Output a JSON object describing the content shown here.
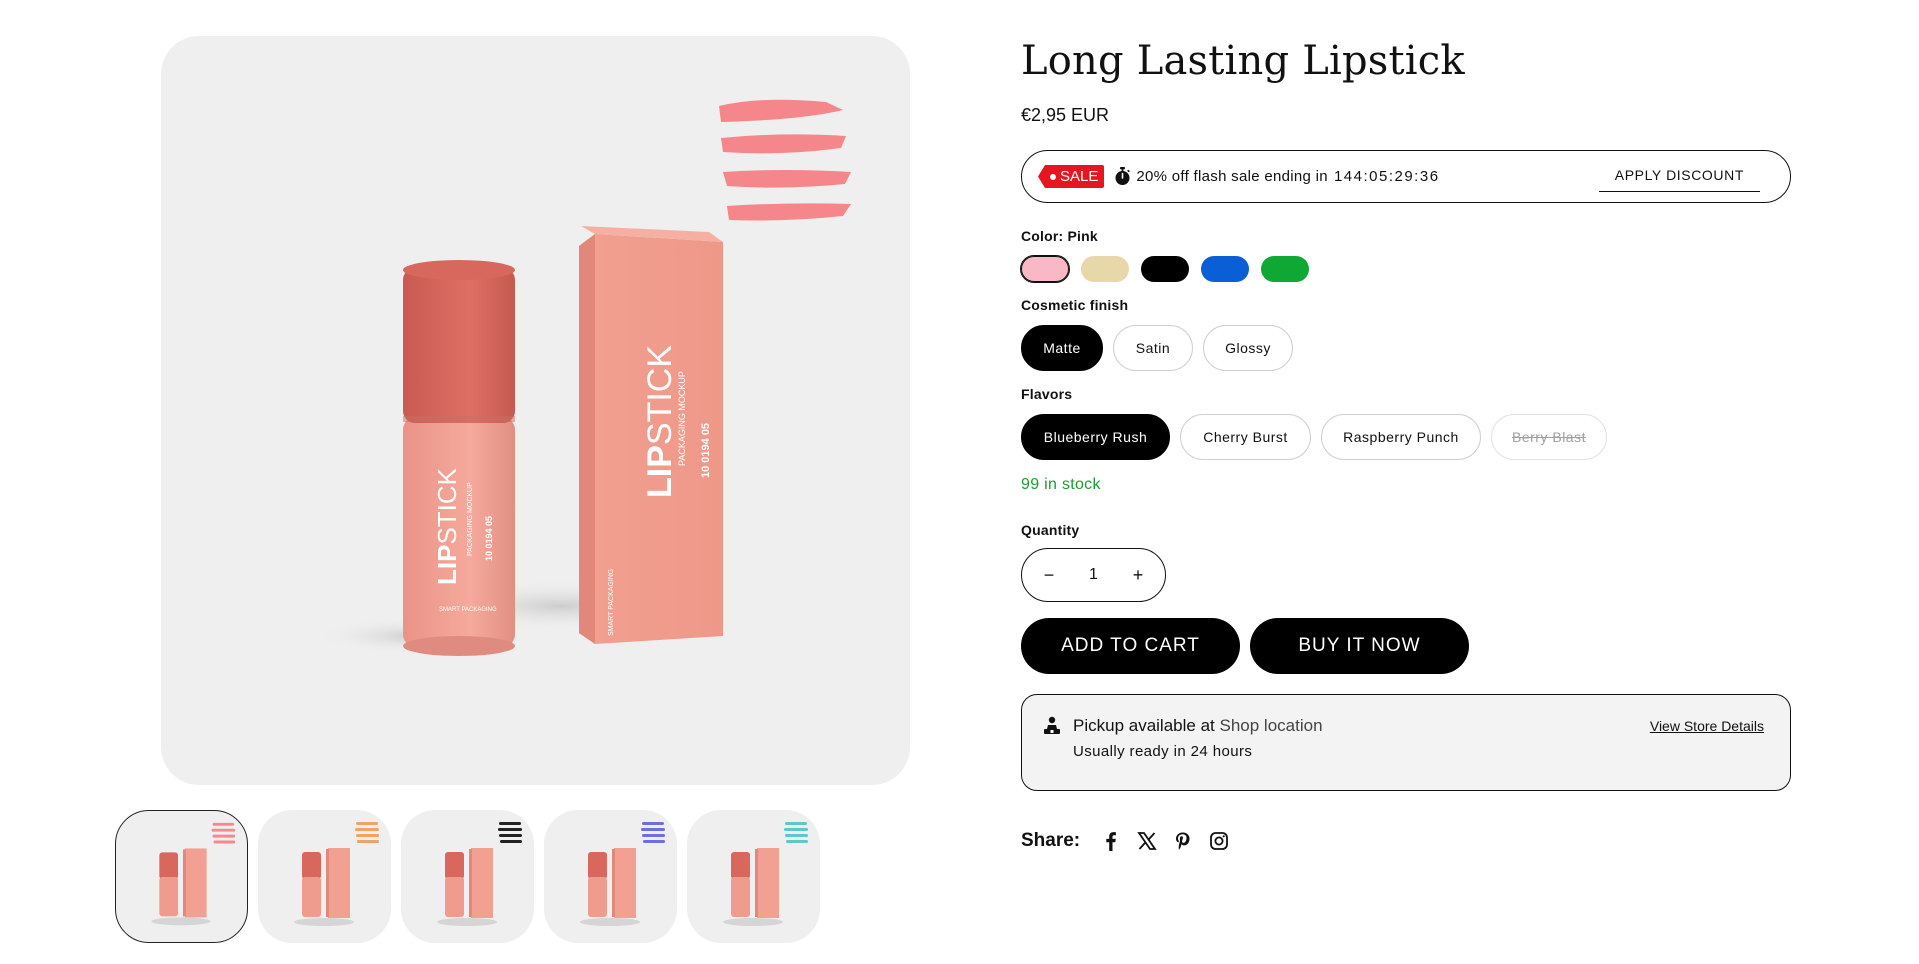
{
  "product": {
    "title": "Long Lasting Lipstick",
    "price": "€2,95 EUR",
    "image_alt_brand": "LIPSTICK",
    "image_sub": "PACKAGING MOCKUP",
    "image_code": "10 0194 05"
  },
  "flash_sale": {
    "badge": "SALE",
    "text": "20% off flash sale ending in",
    "countdown": "144:05:29:36",
    "apply_label": "APPLY DISCOUNT"
  },
  "color": {
    "label": "Color:",
    "selected": "Pink",
    "swatches": [
      {
        "name": "Pink",
        "hex": "#f9b8c6"
      },
      {
        "name": "Beige",
        "hex": "#e8d7a8"
      },
      {
        "name": "Black",
        "hex": "#000000"
      },
      {
        "name": "Blue",
        "hex": "#0b5fd6"
      },
      {
        "name": "Green",
        "hex": "#10a835"
      }
    ]
  },
  "finish": {
    "label": "Cosmetic finish",
    "options": [
      "Matte",
      "Satin",
      "Glossy"
    ],
    "selected": "Matte"
  },
  "flavors": {
    "label": "Flavors",
    "options": [
      "Blueberry Rush",
      "Cherry Burst",
      "Raspberry Punch",
      "Berry Blast"
    ],
    "selected": "Blueberry Rush",
    "unavailable": "Berry Blast"
  },
  "stock": "99 in stock",
  "quantity": {
    "label": "Quantity",
    "value": "1",
    "minus": "−",
    "plus": "+"
  },
  "buttons": {
    "add_to_cart": "ADD TO CART",
    "buy_now": "BUY IT NOW"
  },
  "pickup": {
    "prefix": "Pickup available at",
    "location": "Shop location",
    "ready": "Usually ready in 24 hours",
    "link": "View Store Details"
  },
  "share": {
    "label": "Share:",
    "icons": [
      "facebook-icon",
      "x-icon",
      "pinterest-icon",
      "instagram-icon"
    ]
  },
  "thumbnails": {
    "stroke_colors": [
      "#f48a8f",
      "#f2a262",
      "#222222",
      "#6b6fe3",
      "#5cc9c6"
    ]
  },
  "colors": {
    "sale_red": "#e4161f",
    "stock_green": "#1e9b34",
    "package_pink": "#ee9a8e",
    "cap_red": "#d8675e"
  }
}
